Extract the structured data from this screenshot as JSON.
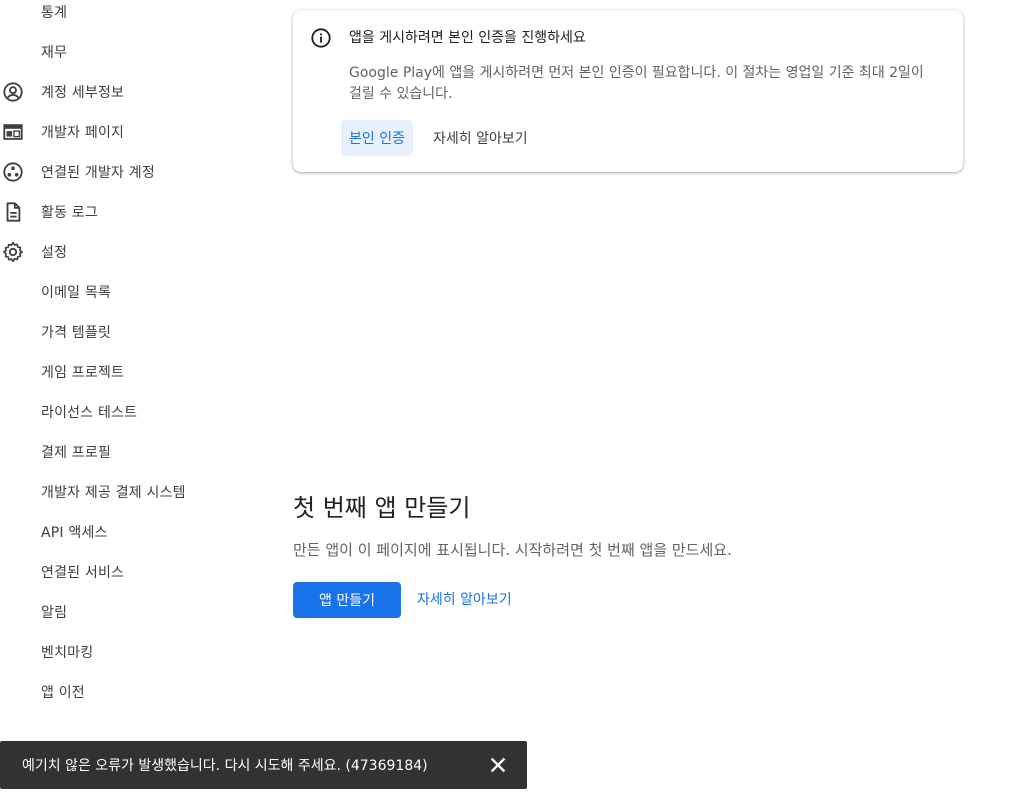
{
  "sidebar": {
    "items": [
      {
        "label": "통계"
      },
      {
        "label": "재무"
      },
      {
        "label": "계정 세부정보",
        "icon": "account-circle-icon"
      },
      {
        "label": "개발자 페이지",
        "icon": "web-page-icon"
      },
      {
        "label": "연결된 개발자 계정",
        "icon": "linked-accounts-icon"
      },
      {
        "label": "활동 로그",
        "icon": "document-icon"
      },
      {
        "label": "설정",
        "icon": "gear-icon"
      },
      {
        "label": "이메일 목록"
      },
      {
        "label": "가격 템플릿"
      },
      {
        "label": "게임 프로젝트"
      },
      {
        "label": "라이선스 테스트"
      },
      {
        "label": "결제 프로필"
      },
      {
        "label": "개발자 제공 결제 시스템"
      },
      {
        "label": "API 액세스"
      },
      {
        "label": "연결된 서비스"
      },
      {
        "label": "알림"
      },
      {
        "label": "벤치마킹"
      },
      {
        "label": "앱 이전"
      }
    ]
  },
  "alert": {
    "title": "앱을 게시하려면 본인 인증을 진행하세요",
    "body": "Google Play에 앱을 게시하려면 먼저 본인 인증이 필요합니다. 이 절차는 영업일 기준 최대 2일이 걸릴 수 있습니다.",
    "primary_label": "본인 인증",
    "secondary_label": "자세히 알아보기"
  },
  "empty_state": {
    "title": "첫 번째 앱 만들기",
    "description": "만든 앱이 이 페이지에 표시됩니다. 시작하려면 첫 번째 앱을 만드세요.",
    "create_label": "앱 만들기",
    "learn_label": "자세히 알아보기"
  },
  "snackbar": {
    "message": "예기치 않은 오류가 발생했습니다. 다시 시도해 주세요. (47369184)"
  },
  "colors": {
    "accent": "#1a73e8",
    "snackbar_bg": "#323232"
  }
}
